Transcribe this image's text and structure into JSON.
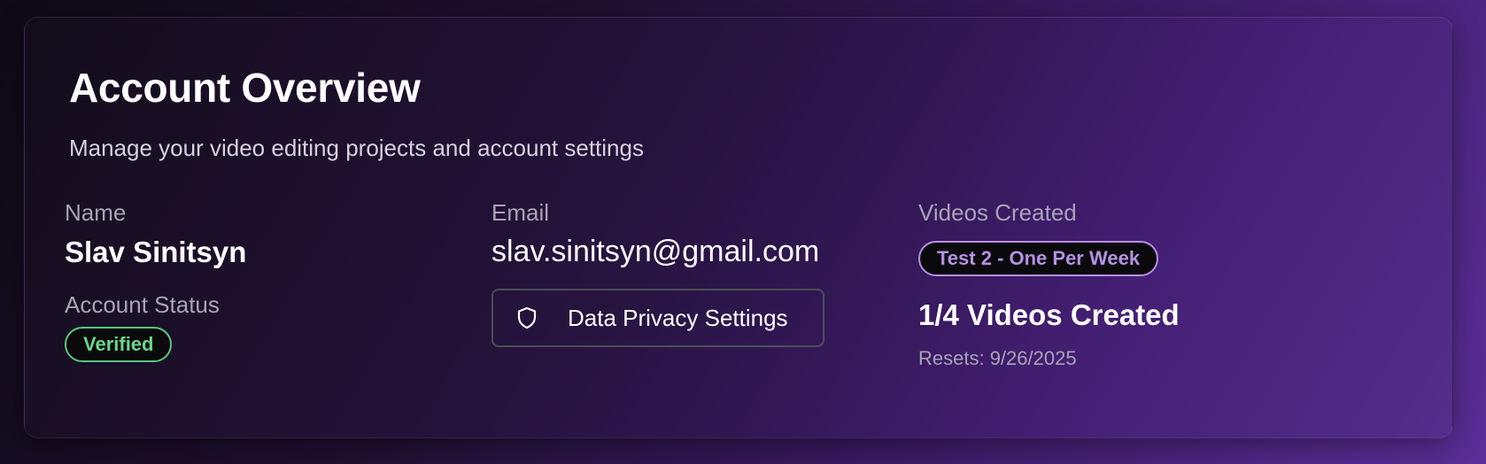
{
  "header": {
    "title": "Account Overview",
    "subtitle": "Manage your video editing projects and account settings"
  },
  "profile": {
    "name_label": "Name",
    "name_value": "Slav Sinitsyn",
    "status_label": "Account Status",
    "status_badge": "Verified",
    "email_label": "Email",
    "email_value": "slav.sinitsyn@gmail.com",
    "privacy_button_label": "Data Privacy Settings",
    "privacy_button_icon": "shield-icon"
  },
  "videos": {
    "label": "Videos Created",
    "plan_badge": "Test 2 - One Per Week",
    "count_text": "1/4 Videos Created",
    "resets_text": "Resets: 9/26/2025"
  },
  "colors": {
    "verified_green": "#58c77a",
    "plan_purple": "#b78ee6",
    "button_border": "#4a4f57"
  }
}
